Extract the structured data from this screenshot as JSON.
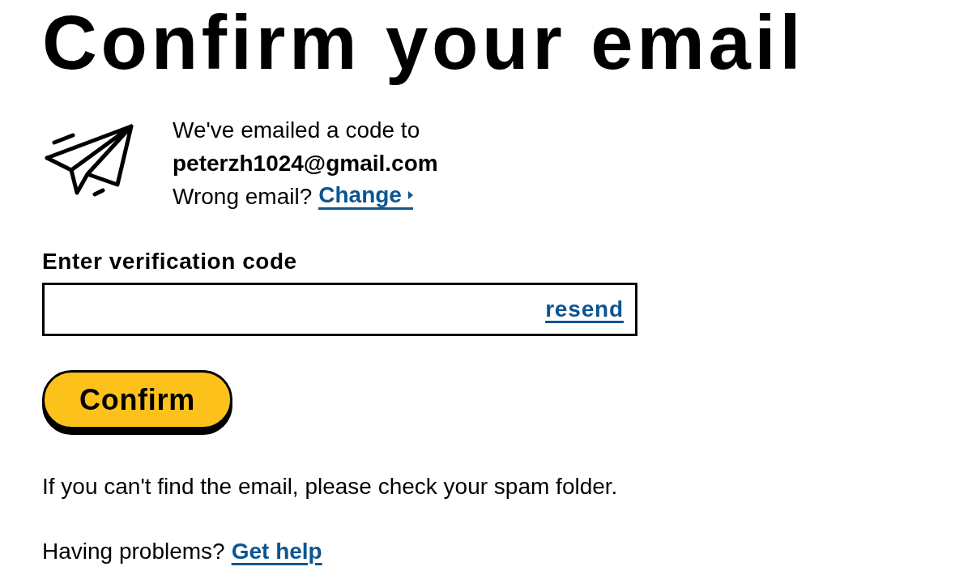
{
  "title": "Confirm your email",
  "sent_notice": {
    "intro": "We've emailed a code to",
    "email": "peterzh1024@gmail.com",
    "wrong_email_prompt": "Wrong email?",
    "change_link": "Change"
  },
  "verification_field": {
    "label": "Enter verification code",
    "resend_link": "resend"
  },
  "confirm_button": "Confirm",
  "spam_hint": "If you can't find the email, please check your spam folder.",
  "help": {
    "prompt": "Having problems?",
    "link": "Get help"
  }
}
